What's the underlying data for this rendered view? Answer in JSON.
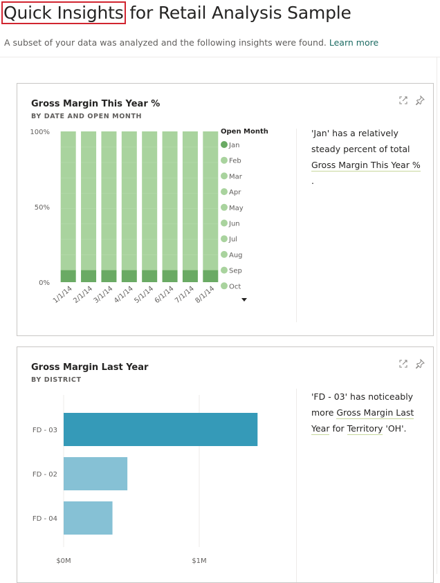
{
  "header": {
    "title_highlight": "Quick Insights",
    "title_rest": " for Retail Analysis Sample",
    "subtitle": "A subset of your data was analyzed and the following insights were found.",
    "learn_more": "Learn more"
  },
  "cards": [
    {
      "title": "Gross Margin This Year %",
      "subtitle": "BY DATE AND OPEN MONTH",
      "icons": [
        "expand-icon",
        "pin-icon"
      ],
      "insight_parts": [
        "'Jan' has a relatively steady percent of total ",
        "Gross Margin This Year %",
        "."
      ],
      "legend_title": "Open Month",
      "legend_items": [
        "Jan",
        "Feb",
        "Mar",
        "Apr",
        "May",
        "Jun",
        "Jul",
        "Aug",
        "Sep",
        "Oct"
      ],
      "legend_more": "more-legend-items"
    },
    {
      "title": "Gross Margin Last Year",
      "subtitle": "BY DISTRICT",
      "icons": [
        "expand-icon",
        "pin-icon"
      ],
      "insight_parts": [
        "'FD - 03' has noticeably more ",
        "Gross Margin Last Year",
        " for ",
        "Territory",
        " 'OH'."
      ]
    }
  ],
  "colors": {
    "jan_dark": "#6aaa64",
    "other_light": "#a9d39e",
    "bar_highlight": "#359ab8",
    "bar_muted": "#86c1d5",
    "red_outline": "#d1242f",
    "link": "#1c6b63"
  },
  "chart_data": [
    {
      "type": "bar",
      "stacked": "100%",
      "title": "Gross Margin This Year %",
      "subtitle": "BY DATE AND OPEN MONTH",
      "categories": [
        "1/1/14",
        "2/1/14",
        "3/1/14",
        "4/1/14",
        "5/1/14",
        "6/1/14",
        "7/1/14",
        "8/1/14"
      ],
      "series": [
        {
          "name": "Jan",
          "values": [
            8,
            8,
            8,
            8,
            8,
            8,
            8,
            8
          ]
        },
        {
          "name": "Other months (Feb–Oct…)",
          "values": [
            92,
            92,
            92,
            92,
            92,
            92,
            92,
            92
          ]
        }
      ],
      "y_ticks": [
        "0%",
        "50%",
        "100%"
      ],
      "ylim": [
        0,
        100
      ],
      "legend": "right",
      "xlabel": "",
      "ylabel": ""
    },
    {
      "type": "bar",
      "orientation": "horizontal",
      "title": "Gross Margin Last Year",
      "subtitle": "BY DISTRICT",
      "categories": [
        "FD - 03",
        "FD - 02",
        "FD - 04"
      ],
      "values": [
        1.43,
        0.47,
        0.36
      ],
      "unit": "$M",
      "x_ticks": [
        "$0M",
        "$1M"
      ],
      "xlim": [
        0,
        1.5
      ],
      "highlight": "FD - 03",
      "xlabel": "",
      "ylabel": ""
    }
  ]
}
